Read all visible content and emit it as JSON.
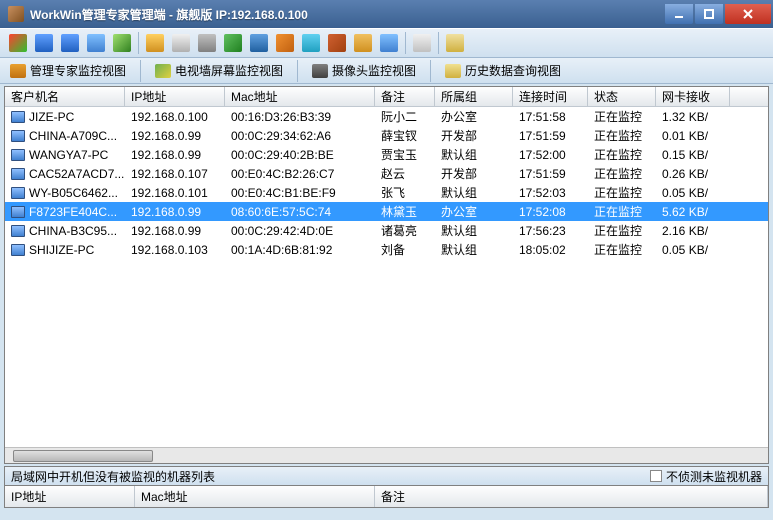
{
  "window": {
    "title": "WorkWin管理专家管理端 - 旗舰版 IP:192.168.0.100"
  },
  "toolbar_icons": [
    {
      "name": "monitor-icon",
      "bg": "linear-gradient(135deg,#ff4030,#30c030)"
    },
    {
      "name": "display-icon",
      "bg": "linear-gradient(to bottom,#60a0ff,#2060c0)"
    },
    {
      "name": "screens-icon",
      "bg": "linear-gradient(to bottom,#60a0ff,#2060c0)"
    },
    {
      "name": "grid-icon",
      "bg": "linear-gradient(to bottom,#80c0ff,#4080d0)"
    },
    {
      "name": "picture-icon",
      "bg": "linear-gradient(135deg,#a0e070,#308020)"
    },
    {
      "name": "sep"
    },
    {
      "name": "folder-icon",
      "bg": "linear-gradient(to bottom,#ffd060,#d09020)"
    },
    {
      "name": "document-icon",
      "bg": "linear-gradient(to bottom,#f0f0f0,#b0b0b0)"
    },
    {
      "name": "trash-icon",
      "bg": "linear-gradient(to bottom,#c0c0c0,#808080)"
    },
    {
      "name": "refresh-icon",
      "bg": "linear-gradient(135deg,#60c060,#208020)"
    },
    {
      "name": "globe-icon",
      "bg": "linear-gradient(to bottom,#60a0e0,#2060a0)"
    },
    {
      "name": "transfer-icon",
      "bg": "linear-gradient(135deg,#f09030,#c06010)"
    },
    {
      "name": "upload-icon",
      "bg": "linear-gradient(to bottom,#60d0f0,#20a0c0)"
    },
    {
      "name": "tools-icon",
      "bg": "linear-gradient(135deg,#d06030,#a04010)"
    },
    {
      "name": "user-icon",
      "bg": "linear-gradient(to bottom,#f0c060,#d09020)"
    },
    {
      "name": "message-icon",
      "bg": "linear-gradient(to bottom,#80c0ff,#4080d0)"
    },
    {
      "name": "sep"
    },
    {
      "name": "task-icon",
      "bg": "linear-gradient(to bottom,#f0f0f0,#c0c0c0)"
    },
    {
      "name": "sep"
    },
    {
      "name": "calendar-icon",
      "bg": "linear-gradient(to bottom,#f0e0a0,#d0b040)"
    }
  ],
  "viewbar": [
    {
      "name": "expert-view",
      "icon_bg": "linear-gradient(to bottom,#e8a030,#c07010)",
      "label": "管理专家监控视图"
    },
    {
      "name": "wall-view",
      "icon_bg": "linear-gradient(135deg,#70b050,#e0d040)",
      "label": "电视墙屏幕监控视图"
    },
    {
      "name": "camera-view",
      "icon_bg": "linear-gradient(to bottom,#808080,#404040)",
      "label": "摄像头监控视图"
    },
    {
      "name": "history-view",
      "icon_bg": "linear-gradient(to bottom,#f0e090,#d0b040)",
      "label": "历史数据查询视图"
    }
  ],
  "columns": {
    "host": "客户机名",
    "ip": "IP地址",
    "mac": "Mac地址",
    "remark": "备注",
    "group": "所属组",
    "time": "连接时间",
    "status": "状态",
    "net": "网卡接收"
  },
  "rows": [
    {
      "host": "JIZE-PC",
      "ip": "192.168.0.100",
      "mac": "00:16:D3:26:B3:39",
      "remark": "阮小二",
      "group": "办公室",
      "time": "17:51:58",
      "status": "正在监控",
      "net": "1.32 KB/"
    },
    {
      "host": "CHINA-A709C...",
      "ip": "192.168.0.99",
      "mac": "00:0C:29:34:62:A6",
      "remark": "薛宝钗",
      "group": "开发部",
      "time": "17:51:59",
      "status": "正在监控",
      "net": "0.01 KB/"
    },
    {
      "host": "WANGYA7-PC",
      "ip": "192.168.0.99",
      "mac": "00:0C:29:40:2B:BE",
      "remark": "贾宝玉",
      "group": "默认组",
      "time": "17:52:00",
      "status": "正在监控",
      "net": "0.15 KB/"
    },
    {
      "host": "CAC52A7ACD7...",
      "ip": "192.168.0.107",
      "mac": "00:E0:4C:B2:26:C7",
      "remark": "赵云",
      "group": "开发部",
      "time": "17:51:59",
      "status": "正在监控",
      "net": "0.26 KB/"
    },
    {
      "host": "WY-B05C6462...",
      "ip": "192.168.0.101",
      "mac": "00:E0:4C:B1:BE:F9",
      "remark": "张飞",
      "group": "默认组",
      "time": "17:52:03",
      "status": "正在监控",
      "net": "0.05 KB/"
    },
    {
      "host": "F8723FE404C...",
      "ip": "192.168.0.99",
      "mac": "08:60:6E:57:5C:74",
      "remark": "林黛玉",
      "group": "办公室",
      "time": "17:52:08",
      "status": "正在监控",
      "net": "5.62 KB/",
      "sel": true
    },
    {
      "host": "CHINA-B3C95...",
      "ip": "192.168.0.99",
      "mac": "00:0C:29:42:4D:0E",
      "remark": "诸葛亮",
      "group": "默认组",
      "time": "17:56:23",
      "status": "正在监控",
      "net": "2.16 KB/"
    },
    {
      "host": "SHIJIZE-PC",
      "ip": "192.168.0.103",
      "mac": "00:1A:4D:6B:81:92",
      "remark": "刘备",
      "group": "默认组",
      "time": "18:05:02",
      "status": "正在监控",
      "net": "0.05 KB/"
    }
  ],
  "bottom": {
    "label": "局域网中开机但没有被监视的机器列表",
    "checkbox": "不侦测未监视机器",
    "col_ip": "IP地址",
    "col_mac": "Mac地址",
    "col_remark": "备注"
  }
}
